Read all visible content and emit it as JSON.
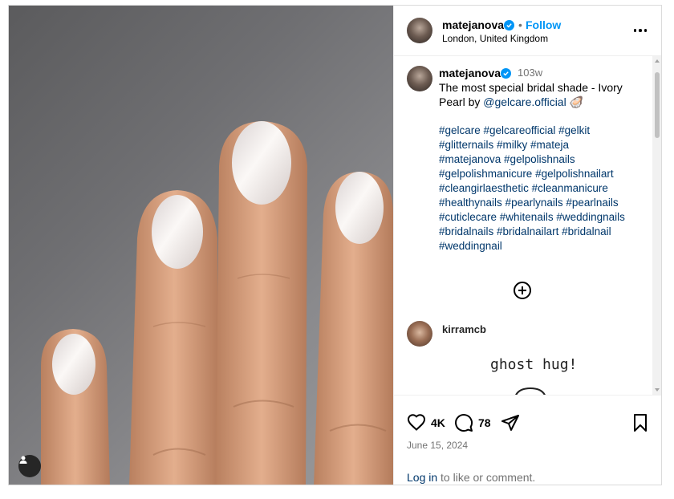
{
  "post": {
    "username": "matejanova",
    "location": "London, United Kingdom",
    "follow_label": "Follow",
    "separator": "•",
    "age": "103w",
    "caption_text": "The most special bridal shade - Ivory Pearl by",
    "caption_mention": "@gelcare.official",
    "caption_emoji": "🦪",
    "hashtags_lines": [
      "#gelcare #gelcareofficial #gelkit",
      "#glitternails #milky #mateja",
      "#matejanova #gelpolishnails",
      "#gelpolishmanicure #gelpolishnailart",
      "#cleangirlaesthetic #cleanmanicure",
      "#healthynails #pearlynails #pearlnails",
      "#cuticlecare #whitenails #weddingnails",
      "#bridalnails #bridalnailart #bridalnail",
      "#weddingnail"
    ],
    "likes": "4K",
    "comments_count": "78",
    "date": "June 15, 2024"
  },
  "comment": {
    "username": "kirramcb",
    "image_text": "ghost hug!"
  },
  "footer": {
    "login_link": "Log in",
    "login_rest": " to like or comment."
  },
  "icons": {
    "verified": "verified-badge-icon",
    "more": "more-options-icon",
    "like": "heart-icon",
    "comment": "comment-icon",
    "share": "paper-plane-icon",
    "save": "bookmark-icon",
    "load_more": "plus-circle-icon",
    "user_tag": "user-tag-icon"
  },
  "colors": {
    "accent": "#0095f6",
    "link": "#00376b",
    "muted": "#737373"
  }
}
